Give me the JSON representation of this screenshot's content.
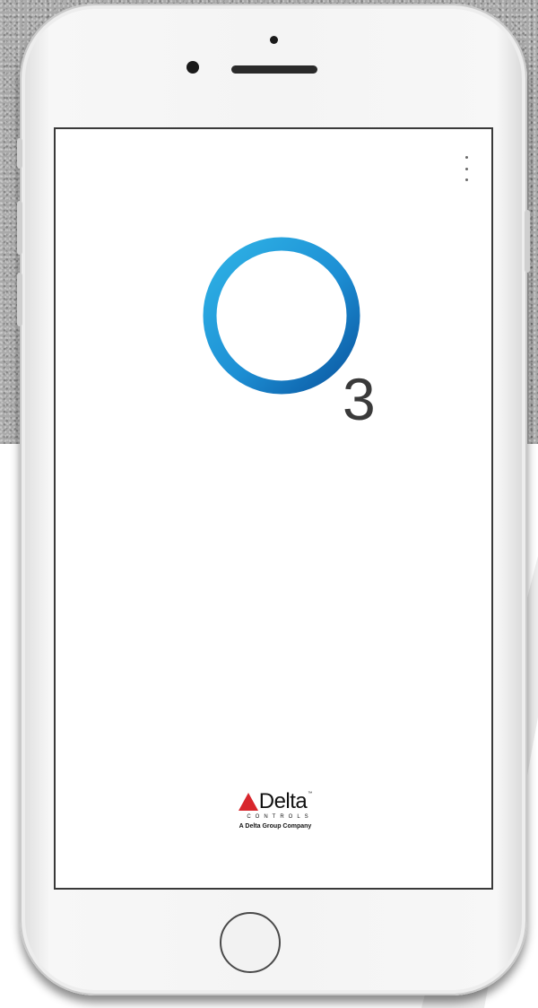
{
  "app": {
    "logo_subscript": "3",
    "menu_icon": "more-vert-icon"
  },
  "brand": {
    "name": "Delta",
    "trademark": "™",
    "sub": "CONTROLS",
    "tagline": "A Delta Group Company"
  },
  "colors": {
    "ring_light": "#27a6dc",
    "ring_dark": "#0b5fa8",
    "brand_red": "#d8262c",
    "text_dark": "#3a3a3a"
  }
}
